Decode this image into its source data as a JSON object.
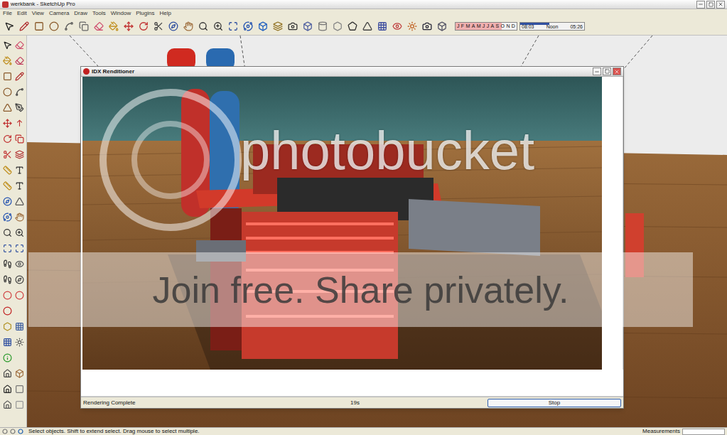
{
  "window": {
    "title": "werkbank - SketchUp Pro"
  },
  "menu": [
    "File",
    "Edit",
    "View",
    "Camera",
    "Draw",
    "Tools",
    "Window",
    "Plugins",
    "Help"
  ],
  "shadow_settings": {
    "months": [
      "J",
      "F",
      "M",
      "A",
      "M",
      "J",
      "J",
      "A",
      "S",
      "O",
      "N",
      "D"
    ],
    "month_level": 0.75,
    "time_start": "08:03",
    "time_mid": "Noon",
    "time_end": "05:26",
    "time_level": 0.45
  },
  "render_window": {
    "title": "IDX Renditioner",
    "status": "Rendering Complete",
    "elapsed": "19s",
    "button": "Stop"
  },
  "status_bar": {
    "hint": "Select objects. Shift to extend select. Drag mouse to select multiple.",
    "measurements": "Measurements"
  },
  "watermark": {
    "logo": "photobucket",
    "tagline": "Join free. Share privately."
  }
}
